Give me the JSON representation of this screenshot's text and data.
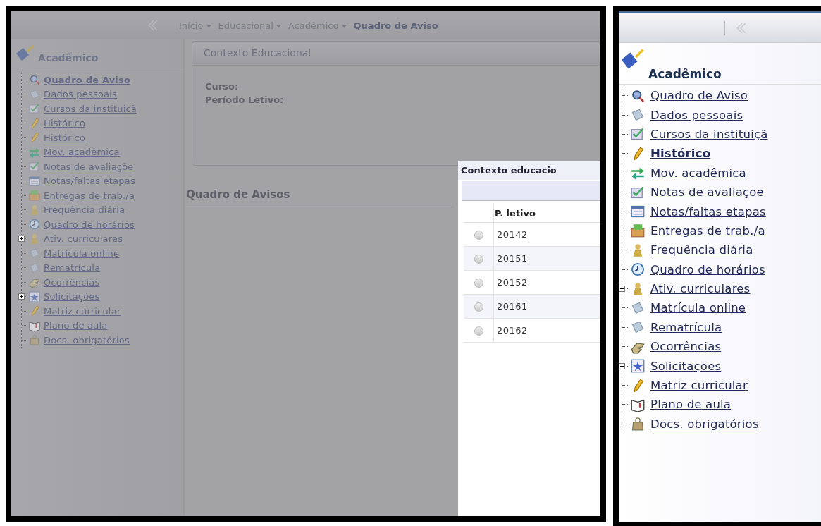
{
  "left_screen": {
    "breadcrumb": [
      {
        "label": "Início",
        "kind": "menu"
      },
      {
        "label": "Educacional",
        "kind": "menu"
      },
      {
        "label": "Acadêmico",
        "kind": "menu"
      },
      {
        "label": "Quadro de Aviso",
        "kind": "current"
      }
    ],
    "sidebar": {
      "title": "Acadêmico",
      "items": [
        {
          "label": "Quadro de Aviso",
          "selected": true,
          "expandable": false
        },
        {
          "label": "Dados pessoais",
          "selected": false,
          "expandable": false
        },
        {
          "label": "Cursos da instituicã",
          "selected": false,
          "expandable": false
        },
        {
          "label": "Histórico",
          "selected": false,
          "expandable": false
        },
        {
          "label": "Histórico",
          "selected": false,
          "expandable": false
        },
        {
          "label": "Mov. acadêmica",
          "selected": false,
          "expandable": false
        },
        {
          "label": "Notas de avaliaçõe",
          "selected": false,
          "expandable": false
        },
        {
          "label": "Notas/faltas etapas",
          "selected": false,
          "expandable": false
        },
        {
          "label": "Entregas de trab./a",
          "selected": false,
          "expandable": false
        },
        {
          "label": "Frequência diária",
          "selected": false,
          "expandable": false
        },
        {
          "label": "Quadro de horários",
          "selected": false,
          "expandable": false
        },
        {
          "label": "Ativ. curriculares",
          "selected": false,
          "expandable": true
        },
        {
          "label": "Matrícula online",
          "selected": false,
          "expandable": false
        },
        {
          "label": "Rematrícula",
          "selected": false,
          "expandable": false
        },
        {
          "label": "Ocorrências",
          "selected": false,
          "expandable": false
        },
        {
          "label": "Solicitações",
          "selected": false,
          "expandable": true
        },
        {
          "label": "Matriz curricular",
          "selected": false,
          "expandable": false
        },
        {
          "label": "Plano de aula",
          "selected": false,
          "expandable": false
        },
        {
          "label": "Docs. obrigatórios",
          "selected": false,
          "expandable": false
        }
      ]
    },
    "context_panel": {
      "title": "Contexto Educacional",
      "fields": [
        "Curso:",
        "Período Letivo:"
      ]
    },
    "section_title": "Quadro de Avisos",
    "dialog": {
      "title": "Contexto educacio",
      "column": "P. letivo",
      "rows": [
        {
          "value": "20142",
          "selected": false
        },
        {
          "value": "20151",
          "selected": false
        },
        {
          "value": "20152",
          "selected": false
        },
        {
          "value": "20161",
          "selected": false
        },
        {
          "value": "20162",
          "selected": false
        }
      ]
    }
  },
  "right_screen": {
    "sidebar": {
      "title": "Acadêmico",
      "items": [
        {
          "label": "Quadro de Aviso",
          "selected": false,
          "expandable": false
        },
        {
          "label": "Dados pessoais",
          "selected": false,
          "expandable": false
        },
        {
          "label": "Cursos da instituiçã",
          "selected": false,
          "expandable": false
        },
        {
          "label": "Histórico",
          "selected": true,
          "expandable": false
        },
        {
          "label": "Mov. acadêmica",
          "selected": false,
          "expandable": false
        },
        {
          "label": "Notas de avaliaçõe",
          "selected": false,
          "expandable": false
        },
        {
          "label": "Notas/faltas etapas",
          "selected": false,
          "expandable": false
        },
        {
          "label": "Entregas de trab./a",
          "selected": false,
          "expandable": false
        },
        {
          "label": "Frequência diária",
          "selected": false,
          "expandable": false
        },
        {
          "label": "Quadro de horários",
          "selected": false,
          "expandable": false
        },
        {
          "label": "Ativ. curriculares",
          "selected": false,
          "expandable": true
        },
        {
          "label": "Matrícula online",
          "selected": false,
          "expandable": false
        },
        {
          "label": "Rematrícula",
          "selected": false,
          "expandable": false
        },
        {
          "label": "Ocorrências",
          "selected": false,
          "expandable": false
        },
        {
          "label": "Solicitações",
          "selected": false,
          "expandable": true
        },
        {
          "label": "Matriz curricular",
          "selected": false,
          "expandable": false
        },
        {
          "label": "Plano de aula",
          "selected": false,
          "expandable": false
        },
        {
          "label": "Docs. obrigatórios",
          "selected": false,
          "expandable": false
        }
      ]
    }
  }
}
